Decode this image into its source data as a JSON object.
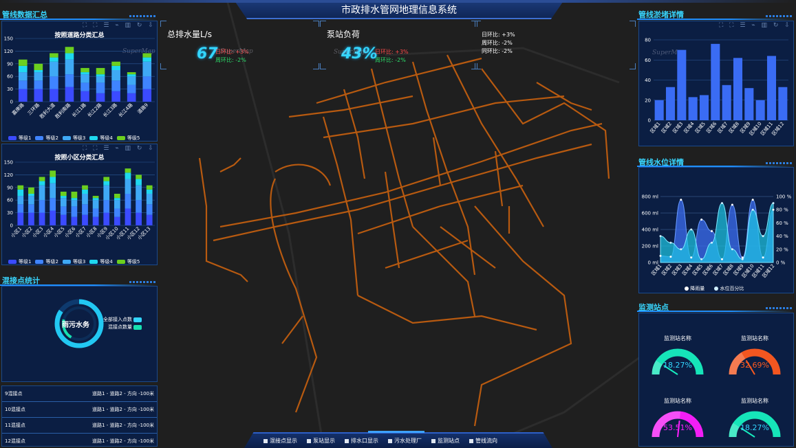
{
  "header": {
    "title": "市政排水管网地理信息系统"
  },
  "watermark": "SuperMap",
  "left": {
    "section1_title": "管线数据汇总",
    "chart1": {
      "title": "按照道路分类汇总"
    },
    "chart2": {
      "title": "按照小区分类汇总"
    },
    "section2_title": "混接点统计",
    "donut": {
      "center_label": "雨污水务",
      "legend": [
        {
          "label": "全部接入点数",
          "color": "#33d6ff"
        },
        {
          "label": "混接点数量",
          "color": "#17e0b0"
        }
      ]
    },
    "table_rows": [
      {
        "name": "9混接点",
        "desc": "道路1 - 道路2 - 方向 -100米"
      },
      {
        "name": "10混接点",
        "desc": "道路1 - 道路2 - 方向 -100米"
      },
      {
        "name": "11混接点",
        "desc": "道路1 - 道路2 - 方向 -100米"
      },
      {
        "name": "12混接点",
        "desc": "道路1 - 道路2 - 方向 -100米"
      }
    ]
  },
  "kpis": [
    {
      "label": "总排水量L/s",
      "value": "67",
      "day": "日环比: +3%",
      "week": "周环比: -2%"
    },
    {
      "label": "泵站负荷",
      "value": "43%",
      "day": "日环比: +3%",
      "week": "周环比: -2%"
    }
  ],
  "kpi_text": {
    "day": "日环比: +3%",
    "week": "周环比: -2%",
    "month": "同环比: -2%"
  },
  "right": {
    "section1_title": "管线淤堵详情",
    "section2_title": "管线水位详情",
    "section3_title": "监测站点",
    "gauges": [
      {
        "name": "监测站名称",
        "value": "18.27%",
        "fraction": 0.1827,
        "color": "#17f0c0",
        "text_color": "#33d6ff"
      },
      {
        "name": "监测站名称",
        "value": "32.69%",
        "fraction": 0.3269,
        "color": "#ff5a1f",
        "text_color": "#ff5a1f"
      },
      {
        "name": "监测站名称",
        "value": "53.51%",
        "fraction": 0.5351,
        "color": "#ff1fff",
        "text_color": "#ff1fff"
      },
      {
        "name": "监测站名称",
        "value": "18.27%",
        "fraction": 0.1827,
        "color": "#17f0c0",
        "text_color": "#33d6ff"
      }
    ]
  },
  "bottom_buttons": [
    "混接点显示",
    "泵站显示",
    "排水口显示",
    "污水处理厂",
    "监测站点",
    "管线流向"
  ],
  "colors": {
    "level1": "#3b4bff",
    "level2": "#3f84ff",
    "level3": "#3fa9f5",
    "level4": "#1fd8ef",
    "level5": "#6ccf1f"
  },
  "chart_data": [
    {
      "type": "bar",
      "stacked": true,
      "title": "按照道路分类汇总",
      "categories": [
        "嘉庚路",
        "三环路",
        "胜利大道",
        "胜利南路",
        "长江1路",
        "长江2路",
        "长江3路",
        "长江4路",
        "道路9"
      ],
      "series": [
        {
          "name": "等级1",
          "color": "#3b4bff",
          "values": [
            30,
            30,
            30,
            35,
            25,
            20,
            25,
            20,
            30
          ]
        },
        {
          "name": "等级2",
          "color": "#3f84ff",
          "values": [
            20,
            20,
            30,
            30,
            20,
            25,
            25,
            20,
            30
          ]
        },
        {
          "name": "等级3",
          "color": "#3fa9f5",
          "values": [
            20,
            20,
            35,
            35,
            20,
            15,
            25,
            20,
            35
          ]
        },
        {
          "name": "等级4",
          "color": "#1fd8ef",
          "values": [
            15,
            5,
            10,
            15,
            5,
            5,
            10,
            5,
            10
          ]
        },
        {
          "name": "等级5",
          "color": "#6ccf1f",
          "values": [
            15,
            15,
            10,
            15,
            10,
            15,
            10,
            5,
            10
          ]
        }
      ],
      "ylim": [
        0,
        150
      ],
      "yticks": [
        0,
        30,
        60,
        90,
        120,
        150
      ]
    },
    {
      "type": "bar",
      "stacked": true,
      "title": "按照小区分类汇总",
      "categories": [
        "小区1",
        "小区2",
        "小区3",
        "小区4",
        "小区5",
        "小区6",
        "小区7",
        "小区8",
        "小区9",
        "小区10",
        "小区11",
        "小区12",
        "小区13"
      ],
      "series": [
        {
          "name": "等级1",
          "color": "#3b4bff",
          "values": [
            30,
            30,
            30,
            35,
            25,
            20,
            25,
            20,
            30,
            20,
            40,
            30,
            25
          ]
        },
        {
          "name": "等级2",
          "color": "#3f84ff",
          "values": [
            20,
            20,
            30,
            30,
            20,
            25,
            25,
            20,
            30,
            20,
            35,
            30,
            25
          ]
        },
        {
          "name": "等级3",
          "color": "#3fa9f5",
          "values": [
            20,
            20,
            35,
            35,
            20,
            15,
            25,
            20,
            35,
            20,
            35,
            35,
            25
          ]
        },
        {
          "name": "等级4",
          "color": "#1fd8ef",
          "values": [
            15,
            5,
            10,
            15,
            5,
            5,
            10,
            5,
            10,
            5,
            15,
            15,
            10
          ]
        },
        {
          "name": "等级5",
          "color": "#6ccf1f",
          "values": [
            10,
            15,
            10,
            15,
            10,
            15,
            10,
            5,
            10,
            10,
            10,
            10,
            10
          ]
        }
      ],
      "ylim": [
        0,
        150
      ],
      "yticks": [
        0,
        30,
        60,
        90,
        120,
        150
      ]
    },
    {
      "type": "bar",
      "title": "",
      "categories": [
        "区域1",
        "区域2",
        "区域3",
        "区域4",
        "区域5",
        "区域6",
        "区域7",
        "区域8",
        "区域9",
        "区域10",
        "区域11",
        "区域12"
      ],
      "values": [
        20,
        33,
        70,
        23,
        25,
        76,
        35,
        62,
        32,
        20,
        64,
        33
      ],
      "ylim": [
        0,
        80
      ],
      "yticks": [
        0,
        20,
        40,
        60,
        80
      ]
    },
    {
      "type": "area",
      "title": "",
      "categories": [
        "区域1",
        "区域2",
        "区域3",
        "区域4",
        "区域5",
        "区域6",
        "区域7",
        "区域8",
        "区域9",
        "区域10",
        "区域11",
        "区域12"
      ],
      "series": [
        {
          "name": "降雨量",
          "axis": "left",
          "values": [
            80,
            70,
            760,
            60,
            520,
            380,
            40,
            700,
            60,
            760,
            60,
            640
          ]
        },
        {
          "name": "水位百分比",
          "axis": "right",
          "values": [
            40,
            30,
            20,
            50,
            5,
            30,
            90,
            20,
            5,
            80,
            40,
            90
          ]
        }
      ],
      "yleft": {
        "ticks": [
          "0 ml",
          "200 ml",
          "400 ml",
          "600 ml",
          "800 ml"
        ],
        "lim": [
          0,
          800
        ]
      },
      "yright": {
        "ticks": [
          "0 %",
          "20 %",
          "40 %",
          "60 %",
          "80 %",
          "100 %"
        ],
        "lim": [
          0,
          100
        ]
      },
      "legend": [
        "降雨量",
        "水位百分比"
      ]
    }
  ]
}
